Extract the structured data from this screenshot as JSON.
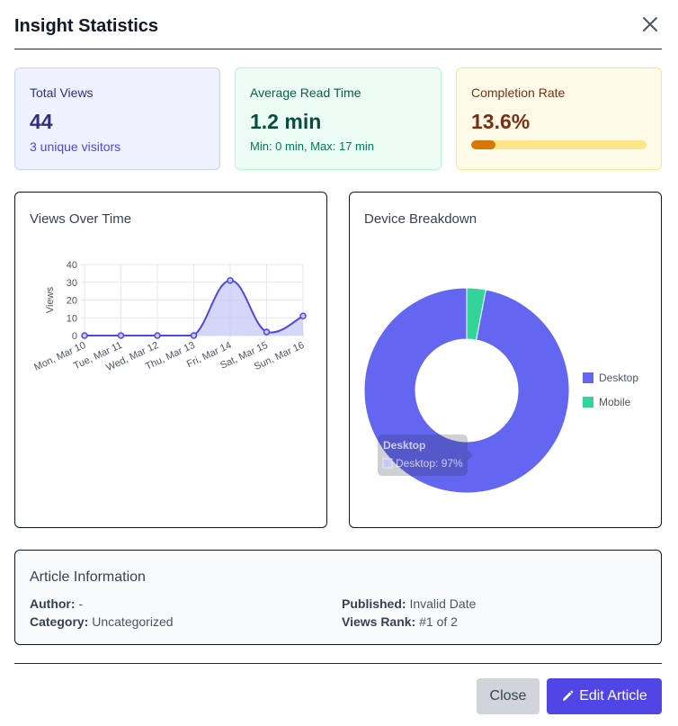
{
  "dialog": {
    "title": "Insight Statistics",
    "close_icon": "close-icon"
  },
  "stats": {
    "total_views": {
      "label": "Total Views",
      "value": "44",
      "sub": "3 unique visitors"
    },
    "avg_read": {
      "label": "Average Read Time",
      "value": "1.2 min",
      "sub": "Min: 0 min, Max: 17 min"
    },
    "completion": {
      "label": "Completion Rate",
      "value": "13.6%",
      "progress": 0.136
    }
  },
  "views_chart": {
    "title": "Views Over Time"
  },
  "device_chart": {
    "title": "Device Breakdown",
    "tooltip_title": "Desktop",
    "tooltip_text": "Desktop: 97%"
  },
  "chart_data": [
    {
      "type": "line",
      "title": "Views Over Time",
      "ylabel": "Views",
      "xlabel": "",
      "categories": [
        "Mon, Mar 10",
        "Tue, Mar 11",
        "Wed, Mar 12",
        "Thu, Mar 13",
        "Fri, Mar 14",
        "Sat, Mar 15",
        "Sun, Mar 16"
      ],
      "series": [
        {
          "values": [
            0,
            0,
            0,
            0,
            31,
            2,
            11
          ]
        }
      ],
      "ylim": [
        0,
        40
      ],
      "yticks": [
        "0",
        "10",
        "20",
        "30",
        "40"
      ],
      "fill": true,
      "grid": true,
      "colors": {
        "line": "#4f46e5",
        "fill": "#c7c9f5"
      }
    },
    {
      "type": "pie",
      "donut": true,
      "title": "Device Breakdown",
      "categories": [
        "Desktop",
        "Mobile"
      ],
      "values": [
        97,
        3
      ],
      "colors": [
        "#6366f1",
        "#34d399"
      ],
      "legend": "right"
    }
  ],
  "article": {
    "title": "Article Information",
    "author_label": "Author:",
    "author_value": "-",
    "category_label": "Category:",
    "category_value": "Uncategorized",
    "published_label": "Published:",
    "published_value": "Invalid Date",
    "rank_label": "Views Rank:",
    "rank_value": "#1 of 2"
  },
  "footer": {
    "close_label": "Close",
    "edit_label": "Edit Article",
    "edit_icon": "pencil-icon"
  }
}
